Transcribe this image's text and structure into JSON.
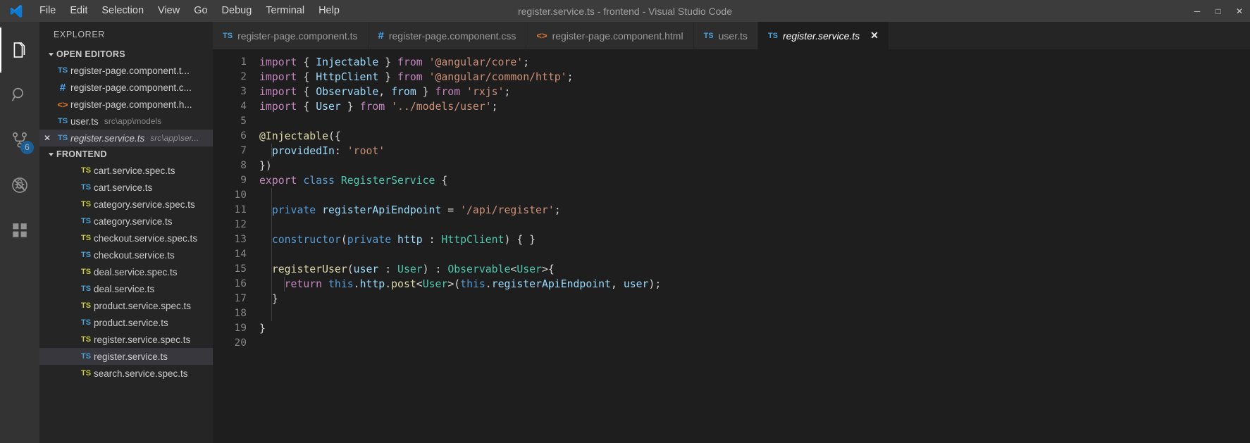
{
  "window": {
    "title": "register.service.ts - frontend - Visual Studio Code",
    "logo_icon": "vscode-logo-icon"
  },
  "menu": {
    "items": [
      {
        "label": "File"
      },
      {
        "label": "Edit"
      },
      {
        "label": "Selection"
      },
      {
        "label": "View"
      },
      {
        "label": "Go"
      },
      {
        "label": "Debug"
      },
      {
        "label": "Terminal"
      },
      {
        "label": "Help"
      }
    ]
  },
  "window_controls": [
    {
      "name": "minimize-button",
      "glyph": "─"
    },
    {
      "name": "maximize-button",
      "glyph": "□"
    },
    {
      "name": "close-button",
      "glyph": "✕"
    }
  ],
  "activity_bar": {
    "items": [
      {
        "name": "explorer-icon",
        "label": "Explorer",
        "active": true,
        "badge": ""
      },
      {
        "name": "search-icon",
        "label": "Search",
        "active": false,
        "badge": ""
      },
      {
        "name": "source-control-icon",
        "label": "Source Control",
        "active": false,
        "badge": "6"
      },
      {
        "name": "debug-icon",
        "label": "Run and Debug",
        "active": false,
        "badge": ""
      },
      {
        "name": "extensions-icon",
        "label": "Extensions",
        "active": false,
        "badge": ""
      }
    ],
    "badge_color": "#0e7ad4"
  },
  "sidebar": {
    "title": "EXPLORER",
    "open_editors": {
      "label": "OPEN EDITORS",
      "expanded": true,
      "items": [
        {
          "icon": "ts",
          "name": "register-page.component.t...",
          "path": "",
          "italic": false,
          "selected": false,
          "dirty_close": false
        },
        {
          "icon": "css",
          "name": "register-page.component.c...",
          "path": "",
          "italic": false,
          "selected": false,
          "dirty_close": false
        },
        {
          "icon": "html",
          "name": "register-page.component.h...",
          "path": "",
          "italic": false,
          "selected": false,
          "dirty_close": false
        },
        {
          "icon": "ts",
          "name": "user.ts",
          "path": "src\\app\\models",
          "italic": false,
          "selected": false,
          "dirty_close": false
        },
        {
          "icon": "ts",
          "name": "register.service.ts",
          "path": "src\\app\\ser...",
          "italic": true,
          "selected": true,
          "dirty_close": true
        }
      ]
    },
    "workspace": {
      "label": "FRONTEND",
      "expanded": true,
      "files": [
        {
          "icon": "spec",
          "name": "cart.service.spec.ts",
          "selected": false
        },
        {
          "icon": "ts",
          "name": "cart.service.ts",
          "selected": false
        },
        {
          "icon": "spec",
          "name": "category.service.spec.ts",
          "selected": false
        },
        {
          "icon": "ts",
          "name": "category.service.ts",
          "selected": false
        },
        {
          "icon": "spec",
          "name": "checkout.service.spec.ts",
          "selected": false
        },
        {
          "icon": "ts",
          "name": "checkout.service.ts",
          "selected": false
        },
        {
          "icon": "spec",
          "name": "deal.service.spec.ts",
          "selected": false
        },
        {
          "icon": "ts",
          "name": "deal.service.ts",
          "selected": false
        },
        {
          "icon": "spec",
          "name": "product.service.spec.ts",
          "selected": false
        },
        {
          "icon": "ts",
          "name": "product.service.ts",
          "selected": false
        },
        {
          "icon": "spec",
          "name": "register.service.spec.ts",
          "selected": false
        },
        {
          "icon": "ts",
          "name": "register.service.ts",
          "selected": true
        },
        {
          "icon": "spec",
          "name": "search.service.spec.ts",
          "selected": false
        }
      ]
    }
  },
  "tabs": [
    {
      "icon": "ts",
      "label": "register-page.component.ts",
      "active": false,
      "italic": false,
      "closable": false
    },
    {
      "icon": "css",
      "label": "register-page.component.css",
      "active": false,
      "italic": false,
      "closable": false
    },
    {
      "icon": "html",
      "label": "register-page.component.html",
      "active": false,
      "italic": false,
      "closable": false
    },
    {
      "icon": "ts",
      "label": "user.ts",
      "active": false,
      "italic": false,
      "closable": false
    },
    {
      "icon": "ts",
      "label": "register.service.ts",
      "active": true,
      "italic": true,
      "closable": true,
      "close_glyph": "✕"
    }
  ],
  "code": {
    "language": "typescript",
    "line_numbers": [
      1,
      2,
      3,
      4,
      5,
      6,
      7,
      8,
      9,
      10,
      11,
      12,
      13,
      14,
      15,
      16,
      17,
      18,
      19,
      20
    ],
    "lines": [
      [
        {
          "t": "import ",
          "c": "kw"
        },
        {
          "t": "{ ",
          "c": "pun"
        },
        {
          "t": "Injectable",
          "c": "var"
        },
        {
          "t": " } ",
          "c": "pun"
        },
        {
          "t": "from ",
          "c": "kw"
        },
        {
          "t": "'@angular/core'",
          "c": "str"
        },
        {
          "t": ";",
          "c": "pun"
        }
      ],
      [
        {
          "t": "import ",
          "c": "kw"
        },
        {
          "t": "{ ",
          "c": "pun"
        },
        {
          "t": "HttpClient",
          "c": "var"
        },
        {
          "t": " } ",
          "c": "pun"
        },
        {
          "t": "from ",
          "c": "kw"
        },
        {
          "t": "'@angular/common/http'",
          "c": "str"
        },
        {
          "t": ";",
          "c": "pun"
        }
      ],
      [
        {
          "t": "import ",
          "c": "kw"
        },
        {
          "t": "{ ",
          "c": "pun"
        },
        {
          "t": "Observable",
          "c": "var"
        },
        {
          "t": ", ",
          "c": "pun"
        },
        {
          "t": "from",
          "c": "gray"
        },
        {
          "t": " } ",
          "c": "pun"
        },
        {
          "t": "from ",
          "c": "kw"
        },
        {
          "t": "'rxjs'",
          "c": "str"
        },
        {
          "t": ";",
          "c": "pun"
        }
      ],
      [
        {
          "t": "import ",
          "c": "kw"
        },
        {
          "t": "{ ",
          "c": "pun"
        },
        {
          "t": "User",
          "c": "var"
        },
        {
          "t": " } ",
          "c": "pun"
        },
        {
          "t": "from ",
          "c": "kw"
        },
        {
          "t": "'../models/user'",
          "c": "str"
        },
        {
          "t": ";",
          "c": "pun"
        }
      ],
      [],
      [
        {
          "t": "@Injectable",
          "c": "fn"
        },
        {
          "t": "({",
          "c": "pun"
        }
      ],
      [
        {
          "t": "  ",
          "c": "pun"
        },
        {
          "t": "providedIn",
          "c": "var"
        },
        {
          "t": ": ",
          "c": "pun"
        },
        {
          "t": "'root'",
          "c": "str"
        }
      ],
      [
        {
          "t": "})",
          "c": "pun"
        }
      ],
      [
        {
          "t": "export ",
          "c": "kw"
        },
        {
          "t": "class ",
          "c": "blue"
        },
        {
          "t": "RegisterService",
          "c": "type"
        },
        {
          "t": " {",
          "c": "pun"
        }
      ],
      [],
      [
        {
          "t": "  ",
          "c": "pun"
        },
        {
          "t": "private ",
          "c": "blue"
        },
        {
          "t": "registerApiEndpoint",
          "c": "var"
        },
        {
          "t": " = ",
          "c": "pun"
        },
        {
          "t": "'/api/register'",
          "c": "str"
        },
        {
          "t": ";",
          "c": "pun"
        }
      ],
      [],
      [
        {
          "t": "  ",
          "c": "pun"
        },
        {
          "t": "constructor",
          "c": "blue"
        },
        {
          "t": "(",
          "c": "pun"
        },
        {
          "t": "private ",
          "c": "blue"
        },
        {
          "t": "http",
          "c": "var"
        },
        {
          "t": " : ",
          "c": "pun"
        },
        {
          "t": "HttpClient",
          "c": "type"
        },
        {
          "t": ") { }",
          "c": "pun"
        }
      ],
      [],
      [
        {
          "t": "  ",
          "c": "pun"
        },
        {
          "t": "registerUser",
          "c": "fn"
        },
        {
          "t": "(",
          "c": "pun"
        },
        {
          "t": "user",
          "c": "var"
        },
        {
          "t": " : ",
          "c": "pun"
        },
        {
          "t": "User",
          "c": "type"
        },
        {
          "t": ") : ",
          "c": "pun"
        },
        {
          "t": "Observable",
          "c": "type"
        },
        {
          "t": "<",
          "c": "pun"
        },
        {
          "t": "User",
          "c": "type"
        },
        {
          "t": ">{",
          "c": "pun"
        }
      ],
      [
        {
          "t": "    ",
          "c": "pun"
        },
        {
          "t": "return ",
          "c": "kw"
        },
        {
          "t": "this",
          "c": "blue"
        },
        {
          "t": ".",
          "c": "pun"
        },
        {
          "t": "http",
          "c": "var"
        },
        {
          "t": ".",
          "c": "pun"
        },
        {
          "t": "post",
          "c": "fn"
        },
        {
          "t": "<",
          "c": "pun"
        },
        {
          "t": "User",
          "c": "type"
        },
        {
          "t": ">(",
          "c": "pun"
        },
        {
          "t": "this",
          "c": "blue"
        },
        {
          "t": ".",
          "c": "pun"
        },
        {
          "t": "registerApiEndpoint",
          "c": "var"
        },
        {
          "t": ", ",
          "c": "pun"
        },
        {
          "t": "user",
          "c": "var"
        },
        {
          "t": ");",
          "c": "pun"
        }
      ],
      [
        {
          "t": "  }",
          "c": "pun"
        }
      ],
      [],
      [
        {
          "t": "}",
          "c": "pun"
        }
      ],
      []
    ]
  },
  "colors": {
    "titlebar_bg": "#3c3c3c",
    "activitybar_bg": "#333333",
    "sidebar_bg": "#252526",
    "editor_bg": "#1e1e1e",
    "tab_inactive_bg": "#2d2d2d",
    "selection_bg": "#37373d",
    "ts_icon": "#4a9fd5",
    "spec_icon": "#cbcb41",
    "html_icon": "#e37933"
  }
}
